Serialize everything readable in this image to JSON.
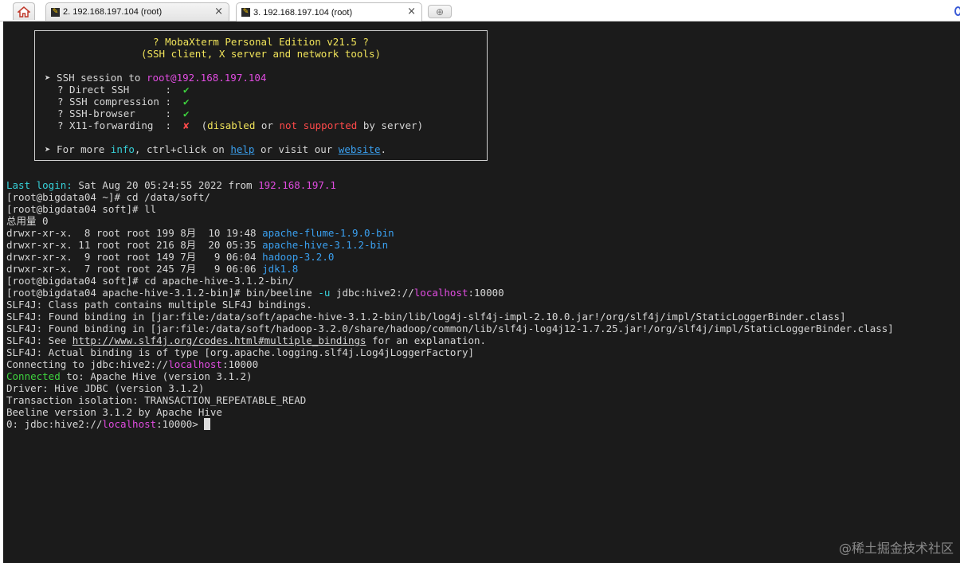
{
  "tabs": [
    {
      "label": "2. 192.168.197.104 (root)",
      "active": false
    },
    {
      "label": "3. 192.168.197.104 (root)",
      "active": true
    }
  ],
  "close_glyph": "×",
  "new_tab_glyph": "⊕",
  "banner": {
    "title": "? MobaXterm Personal Edition v21.5 ?",
    "subtitle": "(SSH client, X server and network tools)",
    "ssh_prefix": "➤ SSH session to ",
    "ssh_target": "root@192.168.197.104",
    "direct_ssh_label": "? Direct SSH      :  ",
    "compression_label": "? SSH compression :  ",
    "browser_label": "? SSH-browser     :  ",
    "x11_label": "? X11-forwarding  :  ",
    "check": "✔",
    "cross": "✘",
    "x11_open": "  (",
    "x11_disabled": "disabled",
    "x11_or": " or ",
    "x11_not_supported": "not supported",
    "x11_by": " by server)",
    "info_prefix": "➤ For more ",
    "info_word": "info",
    "info_mid": ", ctrl+click on ",
    "help_word": "help",
    "info_mid2": " or visit our ",
    "website_word": "website",
    "info_end": "."
  },
  "terminal": {
    "last_login_label": "Last login:",
    "last_login_text": " Sat Aug 20 05:24:55 2022 from ",
    "last_login_ip": "192.168.197.1",
    "cmd1": "[root@bigdata04 ~]# cd /data/soft/",
    "cmd2": "[root@bigdata04 soft]# ll",
    "total": "总用量 0",
    "ls_rows": [
      {
        "meta": "drwxr-xr-x.  8 root root 199 8月  10 19:48 ",
        "name": "apache-flume-1.9.0-bin"
      },
      {
        "meta": "drwxr-xr-x. 11 root root 216 8月  20 05:35 ",
        "name": "apache-hive-3.1.2-bin"
      },
      {
        "meta": "drwxr-xr-x.  9 root root 149 7月   9 06:04 ",
        "name": "hadoop-3.2.0"
      },
      {
        "meta": "drwxr-xr-x.  7 root root 245 7月   9 06:06 ",
        "name": "jdk1.8"
      }
    ],
    "cmd3": "[root@bigdata04 soft]# cd apache-hive-3.1.2-bin/",
    "cmd4_prefix": "[root@bigdata04 apache-hive-3.1.2-bin]# bin/beeline ",
    "cmd4_flag": "-u",
    "cmd4_mid": " jdbc:hive2://",
    "localhost": "localhost",
    "cmd4_port": ":10000",
    "slf1": "SLF4J: Class path contains multiple SLF4J bindings.",
    "slf2": "SLF4J: Found binding in [jar:file:/data/soft/apache-hive-3.1.2-bin/lib/log4j-slf4j-impl-2.10.0.jar!/org/slf4j/impl/StaticLoggerBinder.class]",
    "slf3": "SLF4J: Found binding in [jar:file:/data/soft/hadoop-3.2.0/share/hadoop/common/lib/slf4j-log4j12-1.7.25.jar!/org/slf4j/impl/StaticLoggerBinder.class]",
    "slf4_prefix": "SLF4J: See ",
    "slf4_link": "http://www.slf4j.org/codes.html#multiple_bindings",
    "slf4_suffix": " for an explanation.",
    "slf5": "SLF4J: Actual binding is of type [org.apache.logging.slf4j.Log4jLoggerFactory]",
    "connecting_prefix": "Connecting to jdbc:hive2://",
    "connecting_port": ":10000",
    "connected_word": "Connected",
    "connected_rest": " to: Apache Hive (version 3.1.2)",
    "driver": "Driver: Hive JDBC (version 3.1.2)",
    "isolation": "Transaction isolation: TRANSACTION_REPEATABLE_READ",
    "beeline_version": "Beeline version 3.1.2 by Apache Hive",
    "prompt_prefix": "0: jdbc:hive2://",
    "prompt_suffix": ":10000> "
  },
  "watermark": "@稀土掘金技术社区",
  "colors": {
    "terminal_bg": "#1b1b1b",
    "cyan": "#36d0d8",
    "magenta": "#e04ce0",
    "green": "#3ed33e",
    "red": "#ff4a4a",
    "blue": "#3aa0f0",
    "yellow": "#f0e35a"
  }
}
